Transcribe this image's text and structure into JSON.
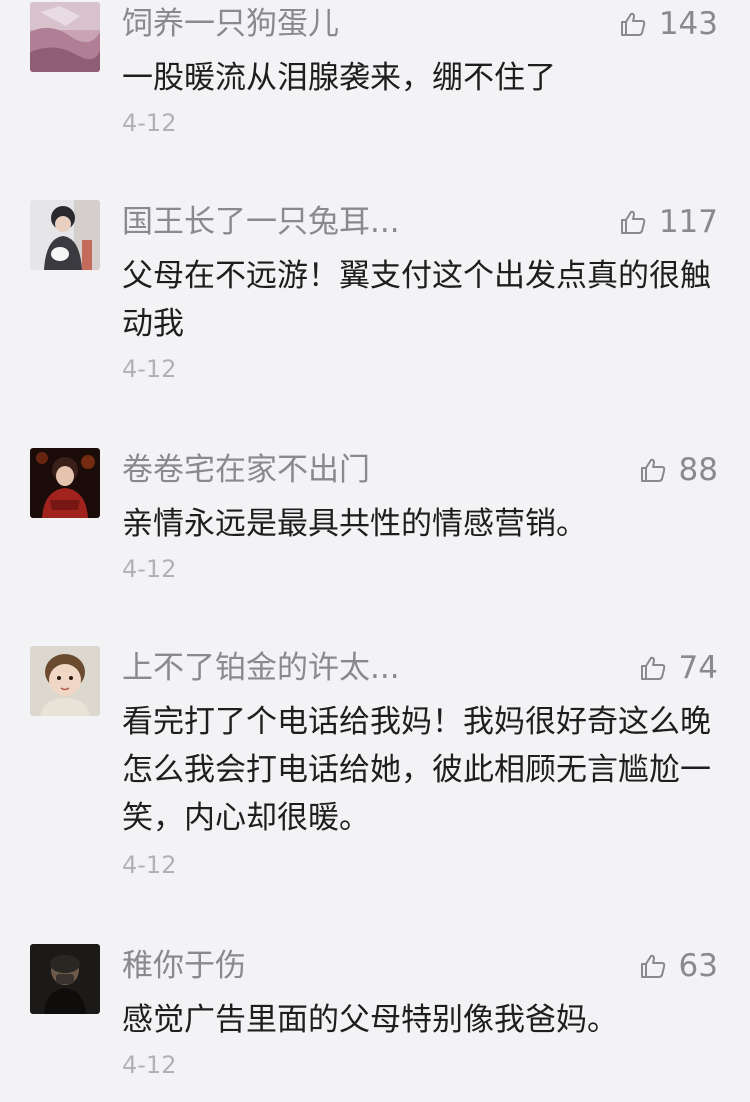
{
  "comments": [
    {
      "username": "饲养一只狗蛋儿",
      "likes": "143",
      "text": "一股暖流从泪腺袭来，绷不住了",
      "date": "4-12",
      "avatar": "pink-landscape-photo"
    },
    {
      "username": "国王长了一只兔耳...",
      "likes": "117",
      "text": "父母在不远游！翼支付这个出发点真的很触动我",
      "date": "4-12",
      "avatar": "person-with-cat-photo"
    },
    {
      "username": "卷卷宅在家不出门",
      "likes": "88",
      "text": "亲情永远是最具共性的情感营销。",
      "date": "4-12",
      "avatar": "performer-stage-photo"
    },
    {
      "username": "上不了铂金的许太...",
      "likes": "74",
      "text": "看完打了个电话给我妈！我妈很好奇这么晚怎么我会打电话给她，彼此相顾无言尴尬一笑，内心却很暖。",
      "date": "4-12",
      "avatar": "child-photo"
    },
    {
      "username": "稚你于伤",
      "likes": "63",
      "text": "感觉广告里面的父母特别像我爸妈。",
      "date": "4-12",
      "avatar": "dark-portrait-photo"
    }
  ],
  "colors": {
    "background": "#f3f3f5",
    "username": "#8a8a8e",
    "text": "#1e1e1e",
    "date": "#b2b2b6"
  },
  "icons": {
    "like": "thumbs-up-icon"
  }
}
